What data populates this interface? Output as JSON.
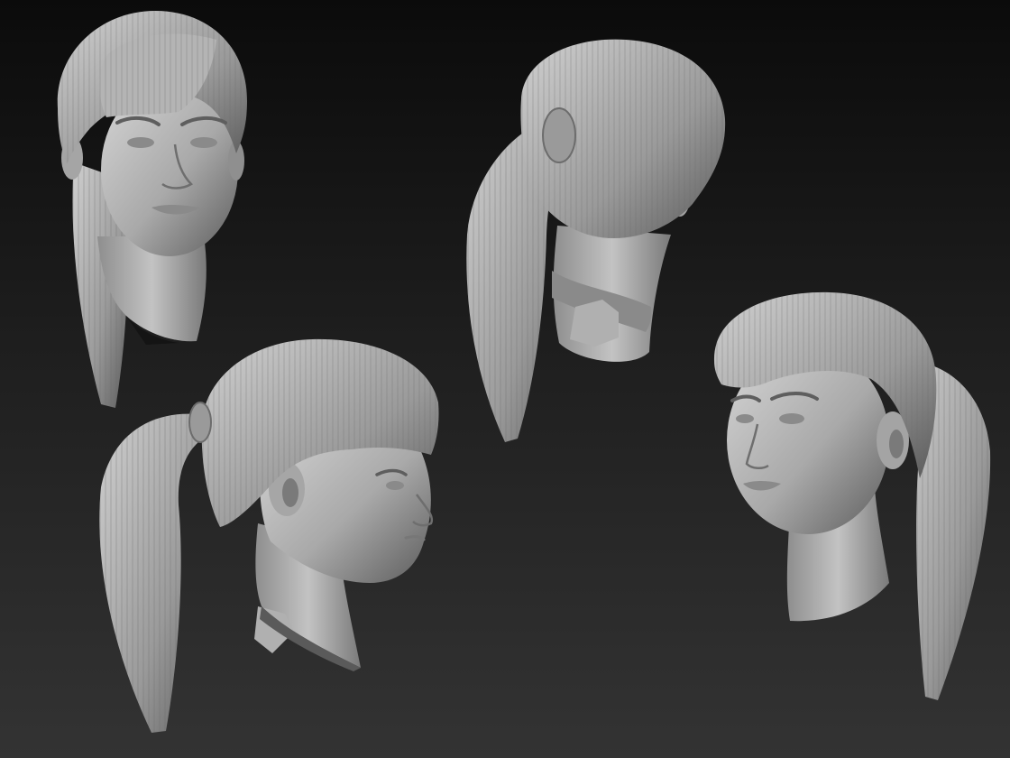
{
  "scene": {
    "background": {
      "top_color": "#0b0b0b",
      "bottom_color": "#333333"
    },
    "clay_color": "#b8b8b8",
    "views": [
      {
        "name": "front-view",
        "hairstyle": "ponytail"
      },
      {
        "name": "back-three-quarter-view",
        "hairstyle": "ponytail"
      },
      {
        "name": "right-profile-view",
        "hairstyle": "ponytail"
      },
      {
        "name": "left-three-quarter-view",
        "hairstyle": "ponytail"
      }
    ]
  }
}
